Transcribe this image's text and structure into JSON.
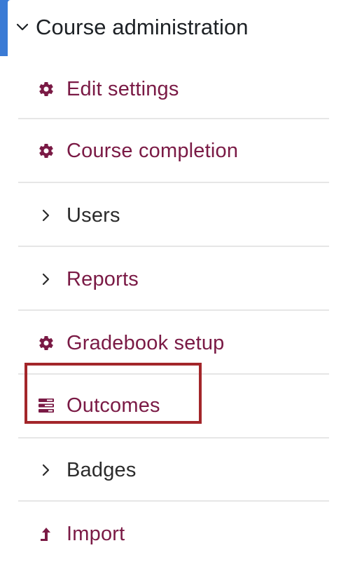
{
  "section": {
    "title": "Course administration",
    "expand_icon": "chevron-down-icon"
  },
  "items": [
    {
      "label": "Edit settings",
      "icon": "gear-icon",
      "style": "link"
    },
    {
      "label": "Course completion",
      "icon": "gear-icon",
      "style": "link"
    },
    {
      "label": "Users",
      "icon": "chevron-right-icon",
      "style": "plain"
    },
    {
      "label": "Reports",
      "icon": "chevron-right-icon",
      "style": "link"
    },
    {
      "label": "Gradebook setup",
      "icon": "gear-icon",
      "style": "link"
    },
    {
      "label": "Outcomes",
      "icon": "outcomes-icon",
      "style": "link"
    },
    {
      "label": "Badges",
      "icon": "chevron-right-icon",
      "style": "plain"
    },
    {
      "label": "Import",
      "icon": "import-icon",
      "style": "link"
    }
  ],
  "colors": {
    "link": "#7a1a45",
    "plain_text": "#2b2b2b",
    "highlight_border": "#a3262a",
    "accent": "#3a7bd5"
  }
}
